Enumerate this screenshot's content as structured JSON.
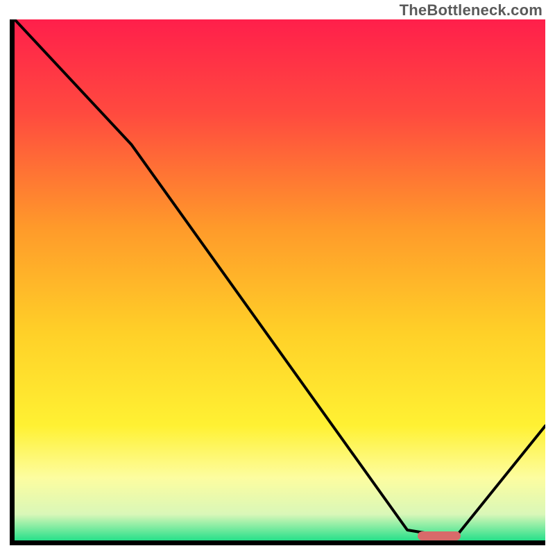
{
  "watermark": "TheBottleneck.com",
  "chart_data": {
    "type": "line",
    "title": "",
    "xlabel": "",
    "ylabel": "",
    "xlim": [
      0,
      100
    ],
    "ylim": [
      0,
      100
    ],
    "series": [
      {
        "name": "bottleneck-curve",
        "x": [
          0,
          22,
          74,
          83,
          100
        ],
        "y": [
          100,
          76,
          2,
          0.5,
          22
        ]
      }
    ],
    "annotations": [
      {
        "name": "optimal-marker",
        "x": 80,
        "y": 0.8,
        "color": "#d86a6a"
      }
    ],
    "background_gradient": {
      "stops": [
        {
          "offset": 0.0,
          "color": "#ff1f4b"
        },
        {
          "offset": 0.18,
          "color": "#ff4a3f"
        },
        {
          "offset": 0.4,
          "color": "#ff9a2a"
        },
        {
          "offset": 0.6,
          "color": "#ffd028"
        },
        {
          "offset": 0.78,
          "color": "#fff133"
        },
        {
          "offset": 0.88,
          "color": "#fdfda0"
        },
        {
          "offset": 0.95,
          "color": "#d9f7b8"
        },
        {
          "offset": 1.0,
          "color": "#27e08a"
        }
      ]
    }
  }
}
